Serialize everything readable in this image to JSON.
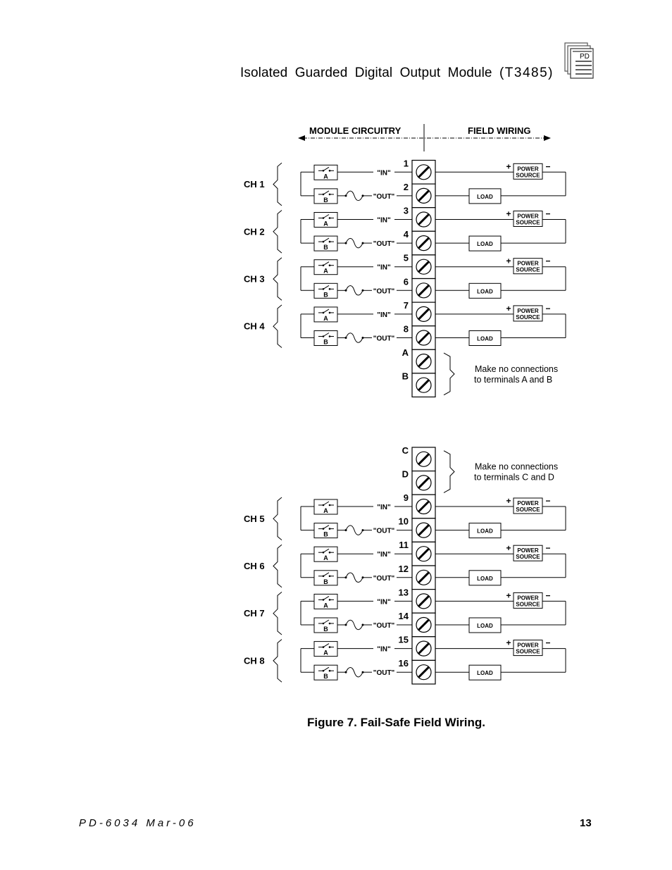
{
  "header": {
    "title": "Isolated Guarded Digital Output Module",
    "model": "(T3485)",
    "logo_text": "PD",
    "logo_icon": "document-stack-icon"
  },
  "diagram": {
    "banner": {
      "left_label": "MODULE CIRCUITRY",
      "right_label": "FIELD WIRING"
    },
    "labels": {
      "in": "\"IN\"",
      "out": "\"OUT\"",
      "switch_a": "A",
      "switch_b": "B",
      "power_line1": "POWER",
      "power_line2": "SOURCE",
      "load": "LOAD",
      "plus": "+",
      "minus": "−"
    },
    "blocks": [
      {
        "channels": [
          {
            "name": "CH 1",
            "in_terminal": "1",
            "out_terminal": "2"
          },
          {
            "name": "CH 2",
            "in_terminal": "3",
            "out_terminal": "4"
          },
          {
            "name": "CH 3",
            "in_terminal": "5",
            "out_terminal": "6"
          },
          {
            "name": "CH 4",
            "in_terminal": "7",
            "out_terminal": "8"
          }
        ],
        "unused_terminals": [
          "A",
          "B"
        ],
        "unused_position": "bottom",
        "note_line1": "Make no connections",
        "note_line2": "to terminals A and B"
      },
      {
        "channels": [
          {
            "name": "CH 5",
            "in_terminal": "9",
            "out_terminal": "10"
          },
          {
            "name": "CH 6",
            "in_terminal": "11",
            "out_terminal": "12"
          },
          {
            "name": "CH 7",
            "in_terminal": "13",
            "out_terminal": "14"
          },
          {
            "name": "CH 8",
            "in_terminal": "15",
            "out_terminal": "16"
          }
        ],
        "unused_terminals": [
          "C",
          "D"
        ],
        "unused_position": "top",
        "note_line1": "Make no connections",
        "note_line2": "to terminals C and D"
      }
    ]
  },
  "caption": "Figure 7.  Fail-Safe Field Wiring.",
  "footer": {
    "doc_id": "PD-6034  Mar-06",
    "page_number": "13"
  }
}
